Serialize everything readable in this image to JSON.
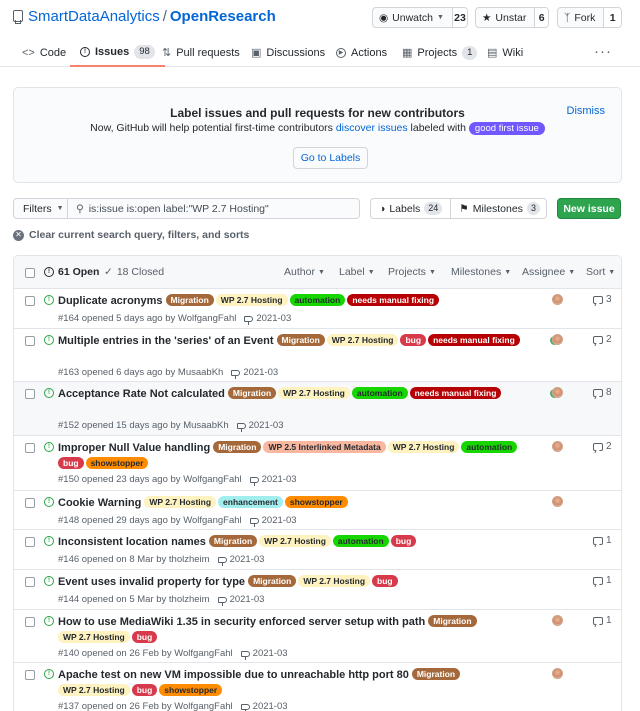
{
  "repo": {
    "owner": "SmartDataAnalytics",
    "separator": "/",
    "name": "OpenResearch"
  },
  "header_buttons": {
    "watch": {
      "label": "Unwatch",
      "count": "23"
    },
    "star": {
      "label": "Unstar",
      "count": "6"
    },
    "fork": {
      "label": "Fork",
      "count": "1"
    }
  },
  "tabs": [
    {
      "label": "Code",
      "icon": "code-icon"
    },
    {
      "label": "Issues",
      "count": "98",
      "icon": "issue-icon",
      "selected": true
    },
    {
      "label": "Pull requests",
      "icon": "pull-request-icon"
    },
    {
      "label": "Discussions",
      "icon": "discussion-icon"
    },
    {
      "label": "Actions",
      "icon": "play-icon"
    },
    {
      "label": "Projects",
      "count": "1",
      "icon": "project-icon"
    },
    {
      "label": "Wiki",
      "icon": "book-icon"
    }
  ],
  "banner": {
    "title": "Label issues and pull requests for new contributors",
    "text_before": "Now, GitHub will help potential first-time contributors",
    "link": "discover issues",
    "text_after": "labeled with",
    "label": "good first issue",
    "dismiss": "Dismiss",
    "button": "Go to Labels"
  },
  "filters": {
    "button": "Filters",
    "query": "is:issue is:open label:\"WP 2.7 Hosting\"",
    "labels": {
      "label": "Labels",
      "count": "24"
    },
    "milestones": {
      "label": "Milestones",
      "count": "3"
    },
    "new_issue": "New issue",
    "clear": "Clear current search query, filters, and sorts"
  },
  "list_header": {
    "open": "61 Open",
    "closed": "18 Closed",
    "columns": [
      "Author",
      "Label",
      "Projects",
      "Milestones",
      "Assignee",
      "Sort"
    ]
  },
  "colors": {
    "Migration": {
      "bg": "#a5683a",
      "fg": "#ffffff"
    },
    "WP 2.7 Hosting": {
      "bg": "#fef2c0",
      "fg": "#24292e"
    },
    "WP 2.5 Interlinked Metadata": {
      "bg": "#f9b7a0",
      "fg": "#24292e"
    },
    "automation": {
      "bg": "#17d600",
      "fg": "#24292e"
    },
    "needs manual fixing": {
      "bg": "#b60205",
      "fg": "#ffffff"
    },
    "bug": {
      "bg": "#d73a4a",
      "fg": "#ffffff"
    },
    "showstopper": {
      "bg": "#ff8c00",
      "fg": "#24292e"
    },
    "enhancement": {
      "bg": "#a2eeef",
      "fg": "#24292e"
    }
  },
  "issues": [
    {
      "title": "Duplicate acronyms",
      "labels": [
        "Migration",
        "WP 2.7 Hosting",
        "automation",
        "needs manual fixing"
      ],
      "meta": "#164 opened 5 days ago by WolfgangFahl",
      "milestone": "2021-03",
      "comments": "3",
      "avatar": true
    },
    {
      "title": "Multiple entries in the 'series' of an Event",
      "labels": [
        "Migration",
        "WP 2.7 Hosting",
        "bug",
        "needs manual fixing"
      ],
      "meta": "#163 opened 6 days ago by MusaabKh",
      "milestone": "2021-03",
      "comments": "2",
      "avatar": true,
      "avatar_two": true
    },
    {
      "title": "Acceptance Rate Not calculated",
      "labels": [
        "Migration",
        "WP 2.7 Hosting",
        "automation",
        "needs manual fixing"
      ],
      "meta": "#152 opened 15 days ago by MusaabKh",
      "milestone": "2021-03",
      "comments": "8",
      "avatar": true,
      "avatar_two": true
    },
    {
      "title": "Improper Null Value handling",
      "labels": [
        "Migration",
        "WP 2.5 Interlinked Metadata",
        "WP 2.7 Hosting",
        "automation",
        "bug",
        "showstopper"
      ],
      "meta": "#150 opened 23 days ago by WolfgangFahl",
      "milestone": "2021-03",
      "comments": "2",
      "avatar": true
    },
    {
      "title": "Cookie Warning",
      "labels": [
        "WP 2.7 Hosting",
        "enhancement",
        "showstopper"
      ],
      "meta": "#148 opened 29 days ago by WolfgangFahl",
      "milestone": "2021-03",
      "comments": "",
      "avatar": true
    },
    {
      "title": "Inconsistent location names",
      "labels": [
        "Migration",
        "WP 2.7 Hosting",
        "automation",
        "bug"
      ],
      "meta": "#146 opened on 8 Mar by tholzheim",
      "milestone": "2021-03",
      "comments": "1",
      "avatar": false
    },
    {
      "title": "Event uses invalid property for type",
      "labels": [
        "Migration",
        "WP 2.7 Hosting",
        "bug"
      ],
      "meta": "#144 opened on 5 Mar by tholzheim",
      "milestone": "2021-03",
      "comments": "1",
      "avatar": false
    },
    {
      "title": "How to use MediaWiki 1.35 in security enforced server setup with path",
      "labels": [
        "Migration",
        "WP 2.7 Hosting",
        "bug"
      ],
      "meta": "#140 opened on 26 Feb by WolfgangFahl",
      "milestone": "2021-03",
      "comments": "1",
      "avatar": true
    },
    {
      "title": "Apache test on new VM impossible due to unreachable http port 80",
      "labels": [
        "Migration",
        "WP 2.7 Hosting",
        "bug",
        "showstopper"
      ],
      "meta": "#137 opened on 26 Feb by WolfgangFahl",
      "milestone": "2021-03",
      "comments": "",
      "avatar": true
    }
  ]
}
